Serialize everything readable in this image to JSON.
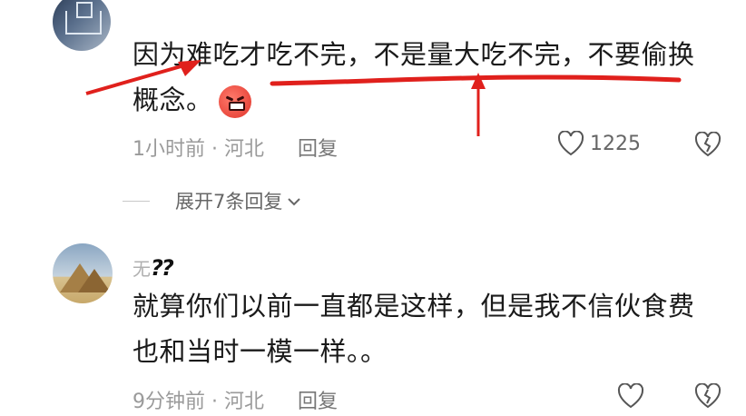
{
  "comments": [
    {
      "line1": "因为难吃才吃不完，不是量大吃不完，不要偷换",
      "line2": "概念。",
      "emoji": "angry-face",
      "time": "1小时前",
      "location": "河北",
      "reply_label": "回复",
      "like_count": "1225"
    },
    {
      "username": "无",
      "username_scribble": "??",
      "line1": "就算你们以前一直都是这样，但是我不信伙食费",
      "line2": "也和当时一模一样。。",
      "time": "9分钟前",
      "location": "河北",
      "reply_label": "回复"
    }
  ],
  "expand_label": "展开7条回复",
  "separator": "·",
  "colors": {
    "annotation": "#e0201c",
    "meta": "#9a9a9a"
  },
  "icons": [
    "heart-outline-icon",
    "broken-heart-icon",
    "chevron-down-icon"
  ]
}
